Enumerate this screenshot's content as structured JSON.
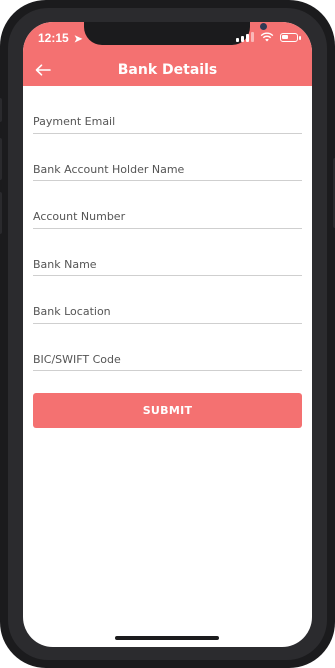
{
  "status_bar": {
    "time": "12:15"
  },
  "header": {
    "title": "Bank Details",
    "back_icon": "arrow-left-icon"
  },
  "form": {
    "fields": [
      {
        "name": "payment-email-input",
        "placeholder": "Payment Email",
        "value": ""
      },
      {
        "name": "bank-account-holder-name-input",
        "placeholder": "Bank Account Holder Name",
        "value": ""
      },
      {
        "name": "account-number-input",
        "placeholder": "Account Number",
        "value": ""
      },
      {
        "name": "bank-name-input",
        "placeholder": "Bank Name",
        "value": ""
      },
      {
        "name": "bank-location-input",
        "placeholder": "Bank Location",
        "value": ""
      },
      {
        "name": "bic-swift-code-input",
        "placeholder": "BIC/SWIFT Code",
        "value": ""
      }
    ],
    "submit_label": "SUBMIT"
  },
  "colors": {
    "accent": "#f47171",
    "frame": "#1b1b1d",
    "underline": "#cfcfcf"
  }
}
